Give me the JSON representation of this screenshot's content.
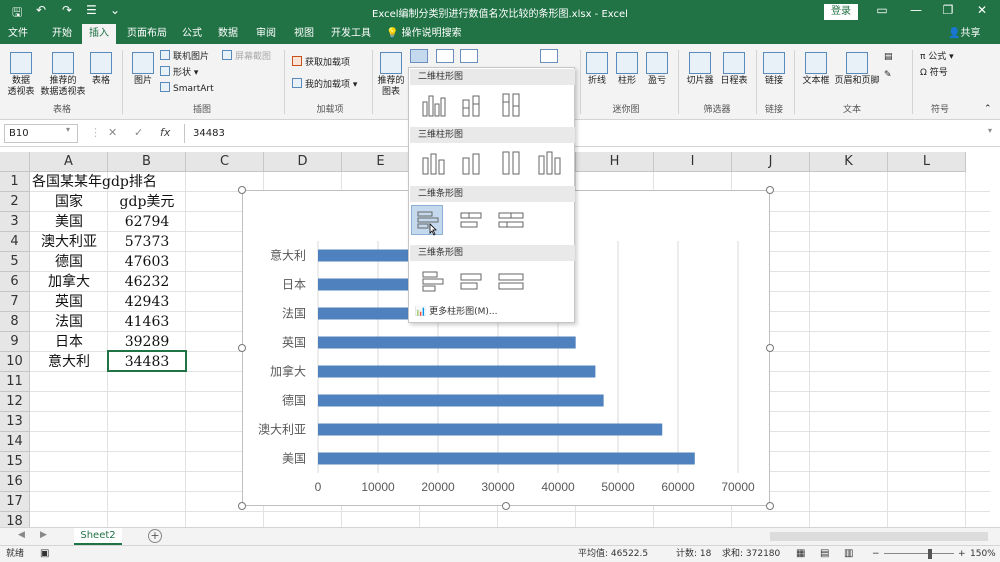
{
  "window": {
    "title": "Excel编制分类别进行数值名次比较的条形图.xlsx - Excel",
    "login": "登录"
  },
  "tabs": [
    {
      "label": "文件",
      "active": false
    },
    {
      "label": "开始",
      "active": false
    },
    {
      "label": "插入",
      "active": true
    },
    {
      "label": "页面布局",
      "active": false
    },
    {
      "label": "公式",
      "active": false
    },
    {
      "label": "数据",
      "active": false
    },
    {
      "label": "审阅",
      "active": false
    },
    {
      "label": "视图",
      "active": false
    },
    {
      "label": "开发工具",
      "active": false
    }
  ],
  "tell_me": "操作说明搜索",
  "share": "共享",
  "ribbon": {
    "pivot_table": "数据\n透视表",
    "rec_pivot": "推荐的\n数据透视表",
    "table": "表格",
    "group_tables": "表格",
    "picture": "图片",
    "online_pic": "联机图片",
    "shapes": "形状",
    "screenshot": "屏幕截图",
    "smartart": "SmartArt",
    "group_illust": "插图",
    "get_addins": "获取加载项",
    "my_addins": "我的加载项",
    "group_addins": "加载项",
    "rec_charts": "推荐的\n图表",
    "line": "折线",
    "column": "柱形",
    "winloss": "盈亏",
    "group_spark": "迷你图",
    "slicer": "切片器",
    "timeline": "日程表",
    "group_filter": "筛选器",
    "link": "链接",
    "group_link": "链接",
    "textbox": "文本框",
    "header_footer": "页眉和页脚",
    "group_text": "文本",
    "formula": "公式",
    "symbol": "符号",
    "group_symbol": "符号"
  },
  "formula_bar": {
    "name_box": "B10",
    "value": "34483"
  },
  "columns": [
    "A",
    "B",
    "C",
    "D",
    "E",
    "F",
    "G",
    "H",
    "I",
    "J",
    "K",
    "L"
  ],
  "rows": [
    "1",
    "2",
    "3",
    "4",
    "5",
    "6",
    "7",
    "8",
    "9",
    "10",
    "11",
    "12",
    "13",
    "14",
    "15",
    "16",
    "17",
    "18"
  ],
  "table": {
    "title": "各国某某年gdp排名",
    "header_country": "国家",
    "header_gdp": "gdp美元",
    "rows": [
      {
        "country": "美国",
        "gdp": "62794"
      },
      {
        "country": "澳大利亚",
        "gdp": "57373"
      },
      {
        "country": "德国",
        "gdp": "47603"
      },
      {
        "country": "加拿大",
        "gdp": "46232"
      },
      {
        "country": "英国",
        "gdp": "42943"
      },
      {
        "country": "法国",
        "gdp": "41463"
      },
      {
        "country": "日本",
        "gdp": "39289"
      },
      {
        "country": "意大利",
        "gdp": "34483"
      }
    ]
  },
  "dropdown": {
    "h1": "二维柱形图",
    "h2": "三维柱形图",
    "h3": "二维条形图",
    "h4": "三维条形图",
    "more": "更多柱形图(M)..."
  },
  "chart_data": {
    "type": "bar",
    "orientation": "horizontal",
    "categories": [
      "美国",
      "澳大利亚",
      "德国",
      "加拿大",
      "英国",
      "法国",
      "日本",
      "意大利"
    ],
    "values": [
      62794,
      57373,
      47603,
      46232,
      42943,
      41463,
      39289,
      34483
    ],
    "xlim": [
      0,
      70000
    ],
    "xticks": [
      "0",
      "10000",
      "20000",
      "30000",
      "40000",
      "50000",
      "60000",
      "70000"
    ],
    "bar_color": "#4e81bd",
    "grid": true
  },
  "sheet": {
    "name": "Sheet2"
  },
  "status": {
    "ready": "就绪",
    "average": "平均值: 46522.5",
    "count": "计数: 18",
    "sum": "求和: 372180",
    "zoom": "150%"
  },
  "colors": {
    "accent": "#217346"
  }
}
